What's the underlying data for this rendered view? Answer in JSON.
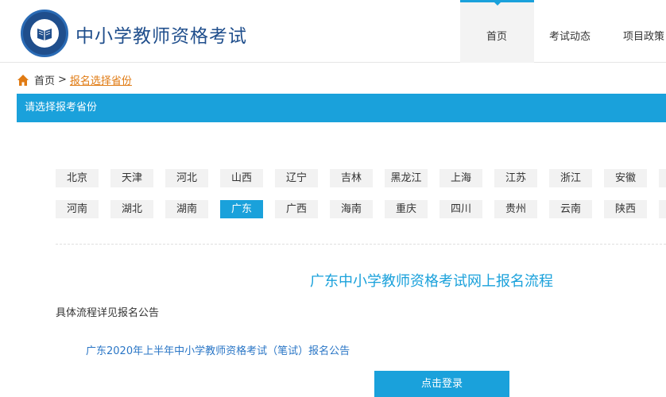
{
  "header": {
    "site_title": "中小学教师资格考试",
    "nav": [
      "首页",
      "考试动态",
      "项目政策"
    ]
  },
  "breadcrumb": {
    "home": "首页",
    "separator": ">",
    "current": "报名选择省份"
  },
  "section_bar": "请选择报考省份",
  "provinces": {
    "row1": [
      "北京",
      "天津",
      "河北",
      "山西",
      "辽宁",
      "吉林",
      "黑龙江",
      "上海",
      "江苏",
      "浙江",
      "安徽"
    ],
    "row2": [
      "河南",
      "湖北",
      "湖南",
      "广东",
      "广西",
      "海南",
      "重庆",
      "四川",
      "贵州",
      "云南",
      "陕西"
    ],
    "selected": "广东"
  },
  "flow": {
    "title": "广东中小学教师资格考试网上报名流程",
    "subtitle": "具体流程详见报名公告",
    "notice_link": "广东2020年上半年中小学教师资格考试（笔试）报名公告",
    "login_button": "点击登录"
  },
  "colors": {
    "accent": "#1aa1db",
    "brand": "#1f4e8c",
    "link": "#2a76c6",
    "crumb_link": "#e07b14"
  }
}
